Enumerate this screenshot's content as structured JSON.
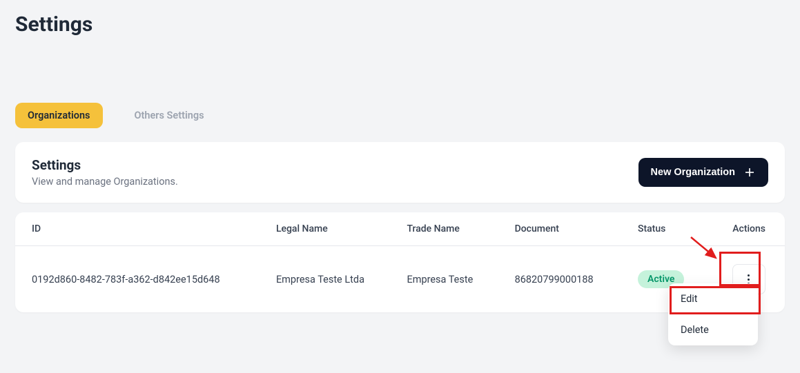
{
  "page": {
    "title": "Settings"
  },
  "tabs": {
    "active": "Organizations",
    "other": "Others Settings"
  },
  "card": {
    "title": "Settings",
    "subtitle": "View and manage Organizations.",
    "new_button_label": "New Organization"
  },
  "table": {
    "headers": {
      "id": "ID",
      "legal_name": "Legal Name",
      "trade_name": "Trade Name",
      "document": "Document",
      "status": "Status",
      "actions": "Actions"
    },
    "rows": [
      {
        "id": "0192d860-8482-783f-a362-d842ee15d648",
        "legal_name": "Empresa Teste Ltda",
        "trade_name": "Empresa Teste",
        "document": "86820799000188",
        "status": "Active"
      }
    ]
  },
  "dropdown": {
    "edit": "Edit",
    "delete": "Delete"
  }
}
